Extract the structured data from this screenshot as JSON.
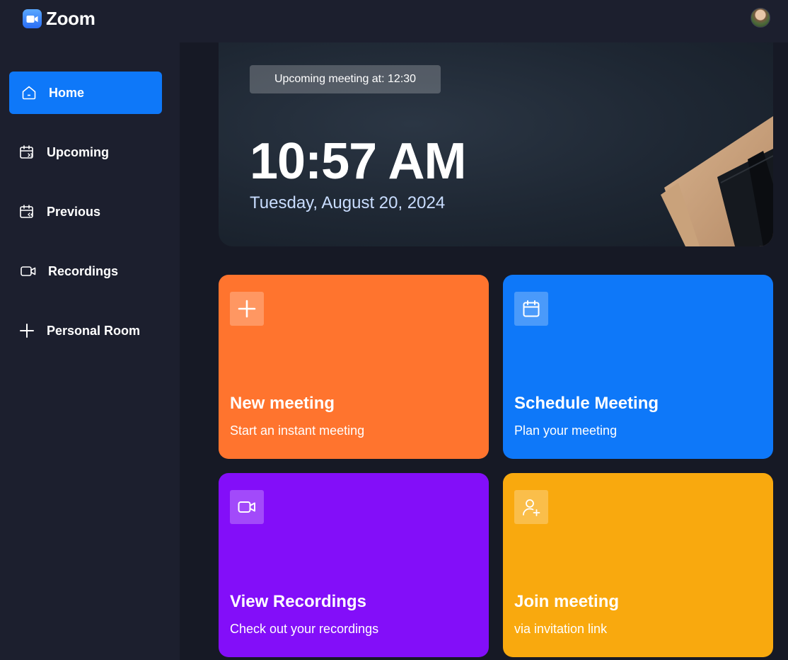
{
  "app": {
    "name": "Zoom"
  },
  "header": {
    "avatar_icon": "user-avatar"
  },
  "sidebar": {
    "items": [
      {
        "label": "Home",
        "icon": "home-icon",
        "active": true
      },
      {
        "label": "Upcoming",
        "icon": "calendar-forward-icon",
        "active": false
      },
      {
        "label": "Previous",
        "icon": "calendar-back-icon",
        "active": false
      },
      {
        "label": "Recordings",
        "icon": "video-icon",
        "active": false
      },
      {
        "label": "Personal Room",
        "icon": "plus-icon",
        "active": false
      }
    ]
  },
  "hero": {
    "badge": "Upcoming meeting at: 12:30",
    "time": "10:57 AM",
    "date": "Tuesday, August 20, 2024"
  },
  "cards": [
    {
      "title": "New meeting",
      "subtitle": "Start an instant meeting",
      "icon": "plus-icon",
      "color": "#ff742e"
    },
    {
      "title": "Schedule Meeting",
      "subtitle": "Plan your meeting",
      "icon": "calendar-icon",
      "color": "#0e78f9"
    },
    {
      "title": "View Recordings",
      "subtitle": "Check out your recordings",
      "icon": "video-icon",
      "color": "#830ef9"
    },
    {
      "title": "Join meeting",
      "subtitle": "via invitation link",
      "icon": "user-add-icon",
      "color": "#f9a90e"
    }
  ],
  "colors": {
    "sidebar_bg": "#1c1f2e",
    "page_bg": "#161925",
    "accent_blue": "#0e78f9"
  }
}
